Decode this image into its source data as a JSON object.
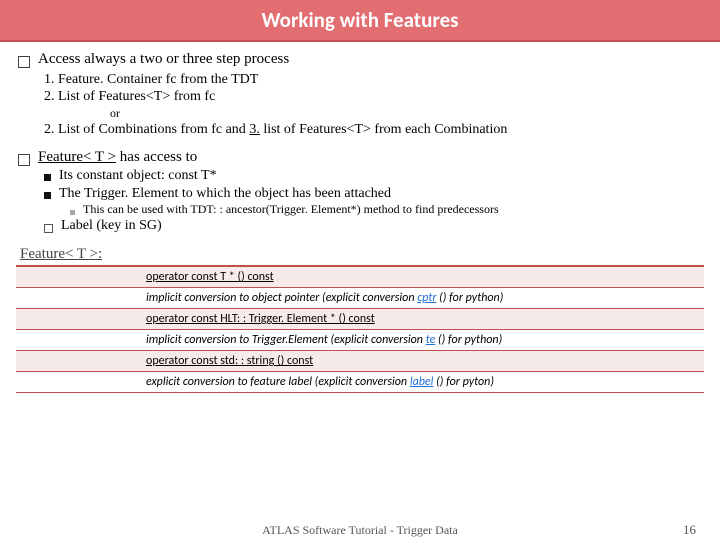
{
  "title": "Working with Features",
  "bullets": {
    "b1": "Access always a two or three step process",
    "b1_1": "1.  Feature. Container fc from the TDT",
    "b1_2": "2. List of Features<T>  from fc",
    "b1_or": "or",
    "b1_3a": "2. List of Combinations from fc and ",
    "b1_3b": "3.",
    "b1_3c": " list of Features<T> from each Combination",
    "b2a": "Feature< T >",
    "b2b": " has access to",
    "b2_1": "Its constant object: const T*",
    "b2_2": "The Trigger. Element to which the object has been attached",
    "b2_2_1": "This can be used with TDT: : ancestor(Trigger. Element*) method to find predecessors",
    "b2_3": "Label (key in SG)"
  },
  "section_header": "Feature< T >:",
  "table": {
    "r1": {
      "t": "operator const T * () const"
    },
    "r2": {
      "a": "implicit conversion to object pointer  (explicit conversion  ",
      "link": "cptr",
      "b": " () for python)"
    },
    "r3": {
      "t": "operator const HLT: : Trigger. Element * () const"
    },
    "r4": {
      "a": "implicit conversion to Trigger.Element  (explicit conversion ",
      "link": "te",
      "b": " () for python)"
    },
    "r5": {
      "t": "operator const std: : string () const"
    },
    "r6": {
      "a": "explicit conversion to feature label  (explicit conversion ",
      "link": "label",
      "b": " ()  for pyton)"
    }
  },
  "footer": {
    "center": "ATLAS Software Tutorial - Trigger Data",
    "page": "16"
  }
}
